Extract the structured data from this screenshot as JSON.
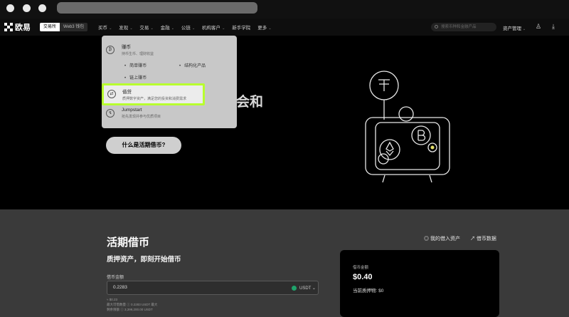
{
  "nav": {
    "logo_text": "欧易",
    "mode_exchange": "交易所",
    "mode_wallet": "Web3 钱包",
    "menu_items": [
      "买币",
      "发现",
      "交易",
      "金融",
      "公链",
      "机构客户",
      "新手学院",
      "更多"
    ],
    "search_placeholder": "搜索币种和金融产品",
    "asset_label": "资产管理"
  },
  "dropdown": {
    "earn_title": "赚币",
    "earn_desc": "持币生币、理财收益",
    "earn_subs": [
      "简单赚币",
      "链上赚币",
      "结构化产品"
    ],
    "loan_title": "借贷",
    "loan_desc": "质押数字资产，满足您的投资和消费需求",
    "jumpstart_title": "Jumpstart",
    "jumpstart_desc": "抢先发现并参与优质项目"
  },
  "hero": {
    "title_fragment": "会和",
    "cta_label": "什么是活期借币?"
  },
  "loan_section": {
    "title": "活期借币",
    "subtitle": "质押资产，即刻开始借币",
    "link_my_loans": "我的借入资产",
    "link_loan_data": "借币数据",
    "amount_label": "借币金额",
    "amount_value": "0.2283",
    "currency": "USDT",
    "meta_line1": "≈ $0.23",
    "meta_line2": "最大可借数量 ⓘ 0.2283 USDT  最大",
    "meta_line3": "剩余限额 ⓘ 3,399,200.00 USDT",
    "card_label": "借币金额",
    "card_value": "$0.40",
    "card_collateral": "当前质押物: $0"
  }
}
